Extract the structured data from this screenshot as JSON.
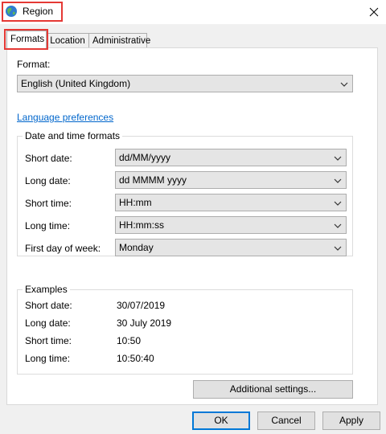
{
  "window": {
    "title": "Region",
    "title_icon": "globe-icon",
    "close_icon": "close-icon"
  },
  "tabs": [
    {
      "label": "Formats",
      "active": true
    },
    {
      "label": "Location",
      "active": false
    },
    {
      "label": "Administrative",
      "active": false
    }
  ],
  "format": {
    "label": "Format:",
    "value": "English (United Kingdom)"
  },
  "language_link": "Language preferences",
  "date_time": {
    "title": "Date and time formats",
    "rows": [
      {
        "label": "Short date:",
        "value": "dd/MM/yyyy"
      },
      {
        "label": "Long date:",
        "value": "dd MMMM yyyy"
      },
      {
        "label": "Short time:",
        "value": "HH:mm"
      },
      {
        "label": "Long time:",
        "value": "HH:mm:ss"
      },
      {
        "label": "First day of week:",
        "value": "Monday"
      }
    ]
  },
  "examples": {
    "title": "Examples",
    "rows": [
      {
        "label": "Short date:",
        "value": "30/07/2019"
      },
      {
        "label": "Long date:",
        "value": "30 July 2019"
      },
      {
        "label": "Short time:",
        "value": "10:50"
      },
      {
        "label": "Long time:",
        "value": "10:50:40"
      }
    ]
  },
  "buttons": {
    "additional_settings": "Additional settings...",
    "ok": "OK",
    "cancel": "Cancel",
    "apply": "Apply"
  },
  "colors": {
    "highlight": "#e53935",
    "link": "#0066cc",
    "default_border": "#0078d7"
  }
}
